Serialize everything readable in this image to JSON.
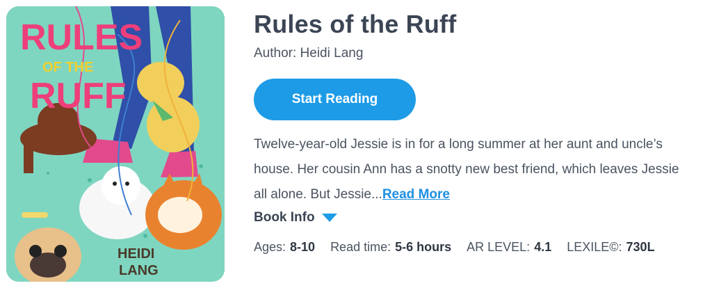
{
  "book": {
    "title": "Rules of the Ruff",
    "author_label": "Author:",
    "author": "Heidi Lang",
    "start_label": "Start Reading",
    "description": "Twelve-year-old Jessie is in for a long summer at her aunt and uncle’s house. Her cousin Ann has a snotty new best friend, which leaves Jessie all alone. But Jessie...",
    "read_more": "Read More",
    "book_info": "Book Info"
  },
  "cover": {
    "title_line1": "RULES",
    "title_line2": "OF THE",
    "title_line3": "RUFF",
    "author_line1": "HEIDI",
    "author_line2": "LANG",
    "background_color": "#7fd6c0",
    "title_color": "#ee3f7a"
  },
  "stats": [
    {
      "label": "Ages:",
      "value": "8-10"
    },
    {
      "label": "Read time:",
      "value": "5-6 hours"
    },
    {
      "label": "AR LEVEL:",
      "value": "4.1"
    },
    {
      "label": "LEXILE©:",
      "value": "730L"
    }
  ],
  "colors": {
    "accent": "#1e9be6",
    "text": "#3b4554"
  }
}
